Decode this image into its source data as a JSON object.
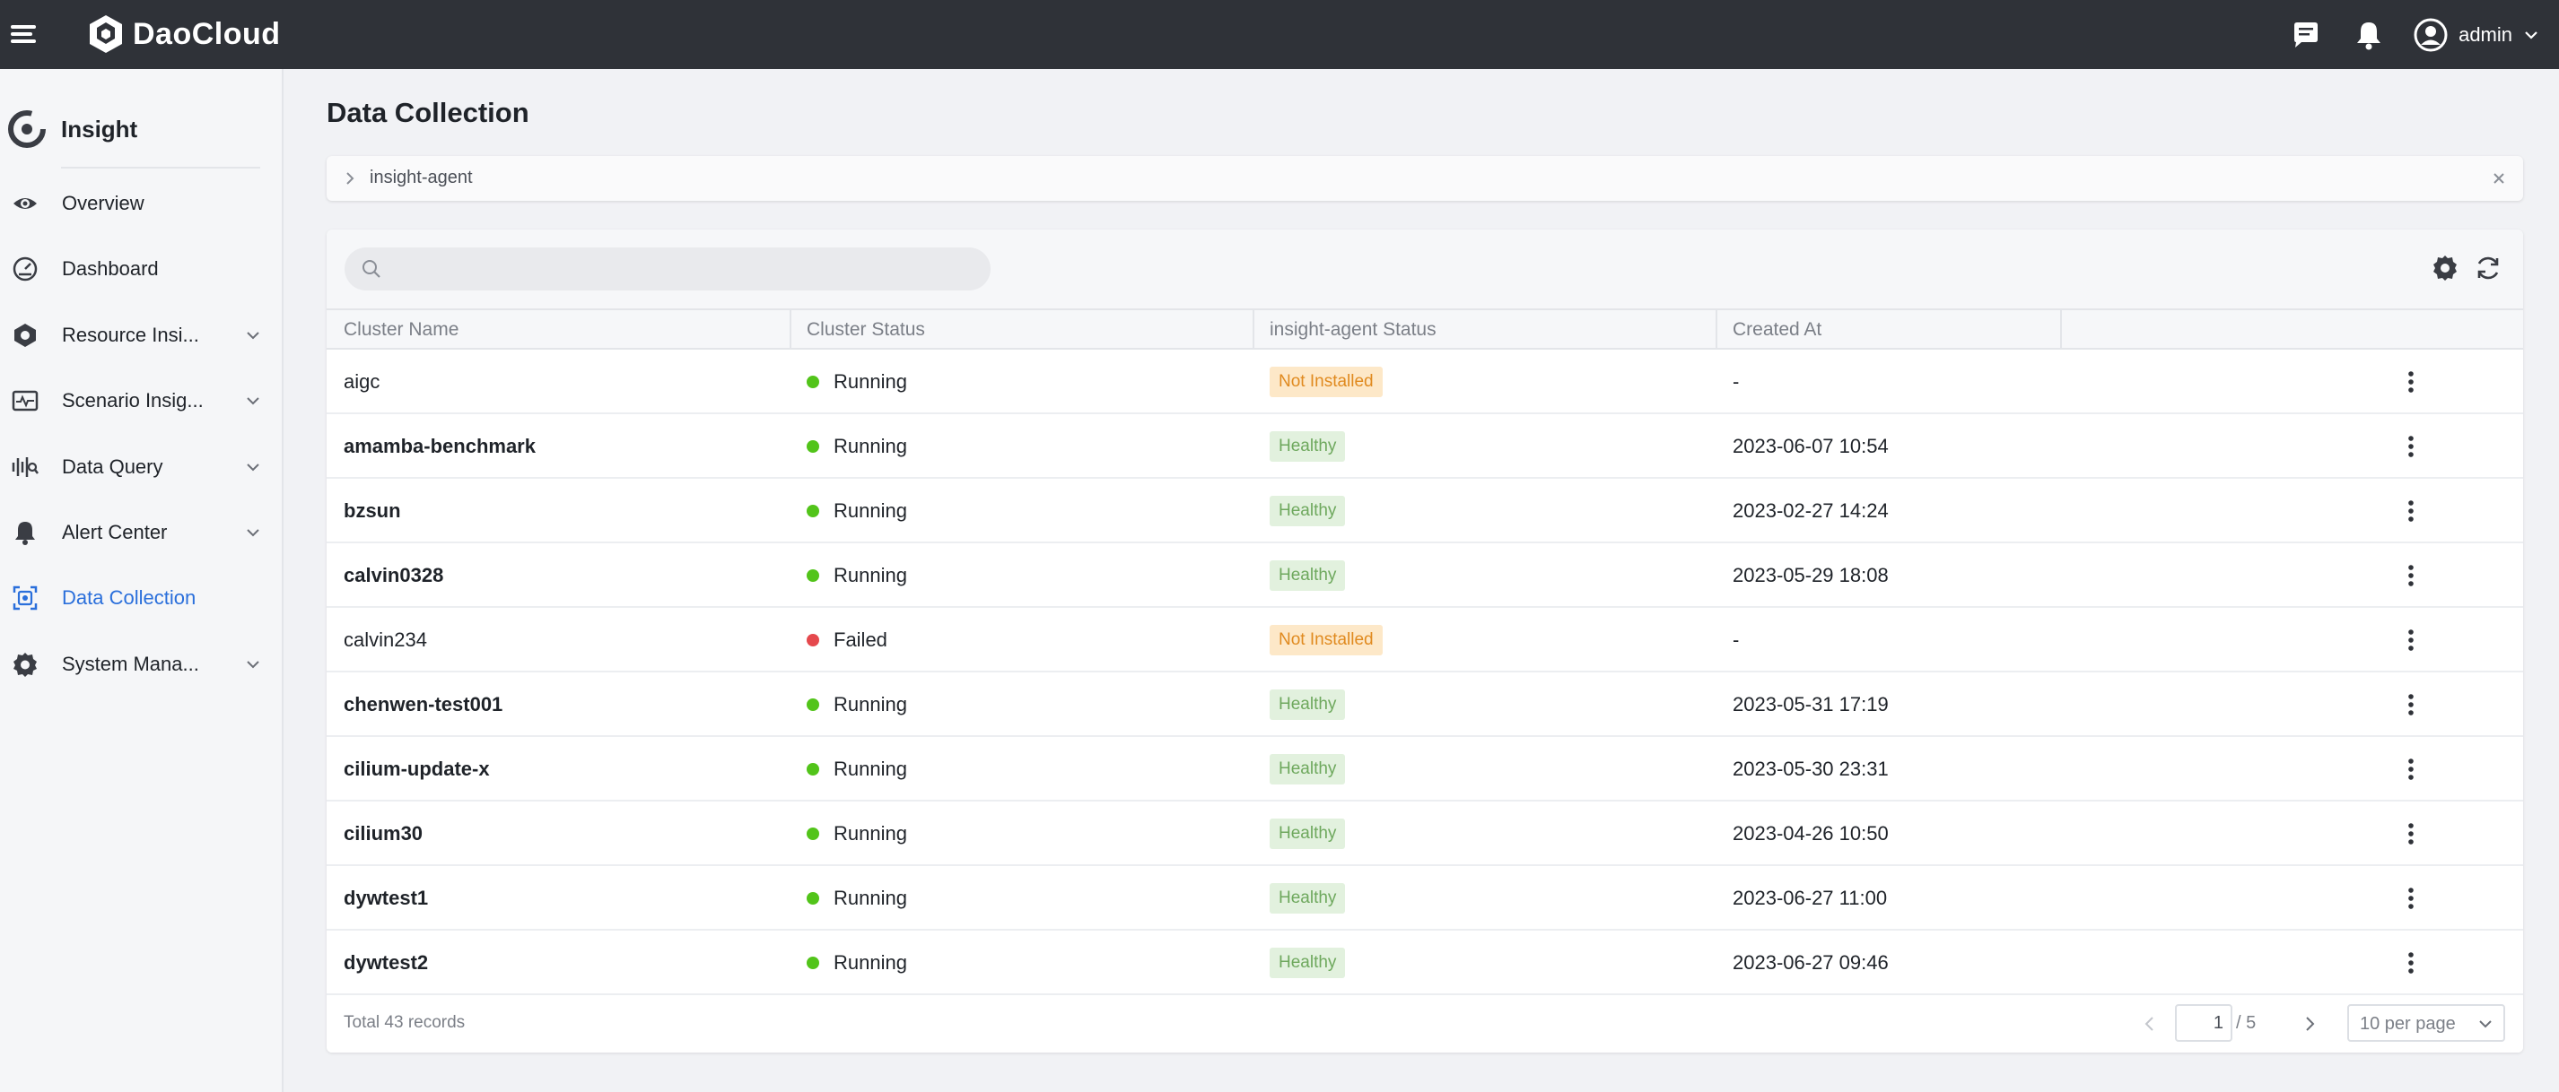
{
  "header": {
    "brand": "DaoCloud",
    "user_name": "admin"
  },
  "sidebar": {
    "title": "Insight",
    "items": [
      {
        "label": "Overview",
        "icon": "eye-icon",
        "has_children": false,
        "active": false
      },
      {
        "label": "Dashboard",
        "icon": "gauge-icon",
        "has_children": false,
        "active": false
      },
      {
        "label": "Resource Insi...",
        "icon": "hexagon-icon",
        "has_children": true,
        "active": false
      },
      {
        "label": "Scenario Insig...",
        "icon": "pulse-monitor-icon",
        "has_children": true,
        "active": false
      },
      {
        "label": "Data Query",
        "icon": "waveform-search-icon",
        "has_children": true,
        "active": false
      },
      {
        "label": "Alert Center",
        "icon": "bell-icon",
        "has_children": true,
        "active": false
      },
      {
        "label": "Data Collection",
        "icon": "collection-frame-icon",
        "has_children": false,
        "active": true
      },
      {
        "label": "System Mana...",
        "icon": "gear-icon",
        "has_children": true,
        "active": false
      }
    ]
  },
  "main": {
    "title": "Data Collection",
    "filter": {
      "label": "insight-agent"
    },
    "search": {
      "placeholder": "",
      "value": ""
    },
    "columns": [
      "Cluster Name",
      "Cluster Status",
      "insight-agent Status",
      "Created At",
      ""
    ],
    "rows": [
      {
        "name": "aigc",
        "name_bold": false,
        "status": "Running",
        "status_color": "#52c41a",
        "agent": "Not Installed",
        "agent_kind": "warn",
        "created": "-"
      },
      {
        "name": "amamba-benchmark",
        "name_bold": true,
        "status": "Running",
        "status_color": "#52c41a",
        "agent": "Healthy",
        "agent_kind": "ok",
        "created": "2023-06-07 10:54"
      },
      {
        "name": "bzsun",
        "name_bold": true,
        "status": "Running",
        "status_color": "#52c41a",
        "agent": "Healthy",
        "agent_kind": "ok",
        "created": "2023-02-27 14:24"
      },
      {
        "name": "calvin0328",
        "name_bold": true,
        "status": "Running",
        "status_color": "#52c41a",
        "agent": "Healthy",
        "agent_kind": "ok",
        "created": "2023-05-29 18:08"
      },
      {
        "name": "calvin234",
        "name_bold": false,
        "status": "Failed",
        "status_color": "#e5484d",
        "agent": "Not Installed",
        "agent_kind": "warn",
        "created": "-"
      },
      {
        "name": "chenwen-test001",
        "name_bold": true,
        "status": "Running",
        "status_color": "#52c41a",
        "agent": "Healthy",
        "agent_kind": "ok",
        "created": "2023-05-31 17:19"
      },
      {
        "name": "cilium-update-x",
        "name_bold": true,
        "status": "Running",
        "status_color": "#52c41a",
        "agent": "Healthy",
        "agent_kind": "ok",
        "created": "2023-05-30 23:31"
      },
      {
        "name": "cilium30",
        "name_bold": true,
        "status": "Running",
        "status_color": "#52c41a",
        "agent": "Healthy",
        "agent_kind": "ok",
        "created": "2023-04-26 10:50"
      },
      {
        "name": "dywtest1",
        "name_bold": true,
        "status": "Running",
        "status_color": "#52c41a",
        "agent": "Healthy",
        "agent_kind": "ok",
        "created": "2023-06-27 11:00"
      },
      {
        "name": "dywtest2",
        "name_bold": true,
        "status": "Running",
        "status_color": "#52c41a",
        "agent": "Healthy",
        "agent_kind": "ok",
        "created": "2023-06-27 09:46"
      }
    ],
    "footer": {
      "total": "Total 43 records",
      "current_page": "1",
      "page_total": "/ 5",
      "per_page": "10 per page"
    }
  },
  "colors": {
    "topbar": "#2f3238",
    "accent": "#2a6fdb",
    "running": "#52c41a",
    "failed": "#e5484d"
  }
}
